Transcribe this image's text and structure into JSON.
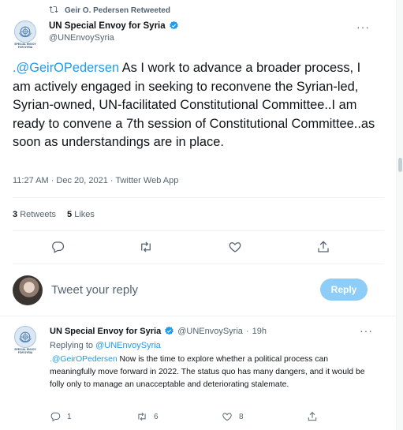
{
  "retweet_banner": {
    "text": "Geir O. Pedersen Retweeted"
  },
  "main_tweet": {
    "avatar_caption": "SPECIAL ENVOY FOR SYRIA",
    "author_name": "UN Special Envoy for Syria",
    "author_handle": "@UNEnvoySyria",
    "mention": ".@GeirOPedersen",
    "text_rest": " As I work to advance a broader process, I am actively engaged in seeking to reconvene the Syrian-led, Syrian-owned, UN-facilitated Constitutional Committee..I am ready to convene a 7th session of Constitutional Committee..as soon as understandings are in place.",
    "timestamp": "11:27 AM · Dec 20, 2021 · Twitter Web App",
    "retweets_count": "3",
    "retweets_label": "Retweets",
    "likes_count": "5",
    "likes_label": "Likes",
    "more_label": "···"
  },
  "reply_composer": {
    "placeholder": "Tweet your reply",
    "button_label": "Reply"
  },
  "reply_tweet": {
    "avatar_caption": "SPECIAL ENVOY FOR SYRIA",
    "author_name": "UN Special Envoy for Syria",
    "author_handle": "@UNEnvoySyria",
    "separator": "·",
    "time": "19h",
    "replying_prefix": "Replying to",
    "replying_to": "@UNEnvoySyria",
    "mention": ".@GeirOPedersen",
    "text_rest": " Now is the time to explore whether a political process can meaningfully move forward in 2022. The status quo has many dangers, and it would be folly only to manage an unacceptable and deteriorating stalemate.",
    "reply_count": "1",
    "retweet_count": "6",
    "like_count": "8",
    "more_label": "···"
  },
  "colors": {
    "accent": "#1d9bf0",
    "muted": "#536471",
    "reply_button_disabled": "#8ecdf7"
  }
}
